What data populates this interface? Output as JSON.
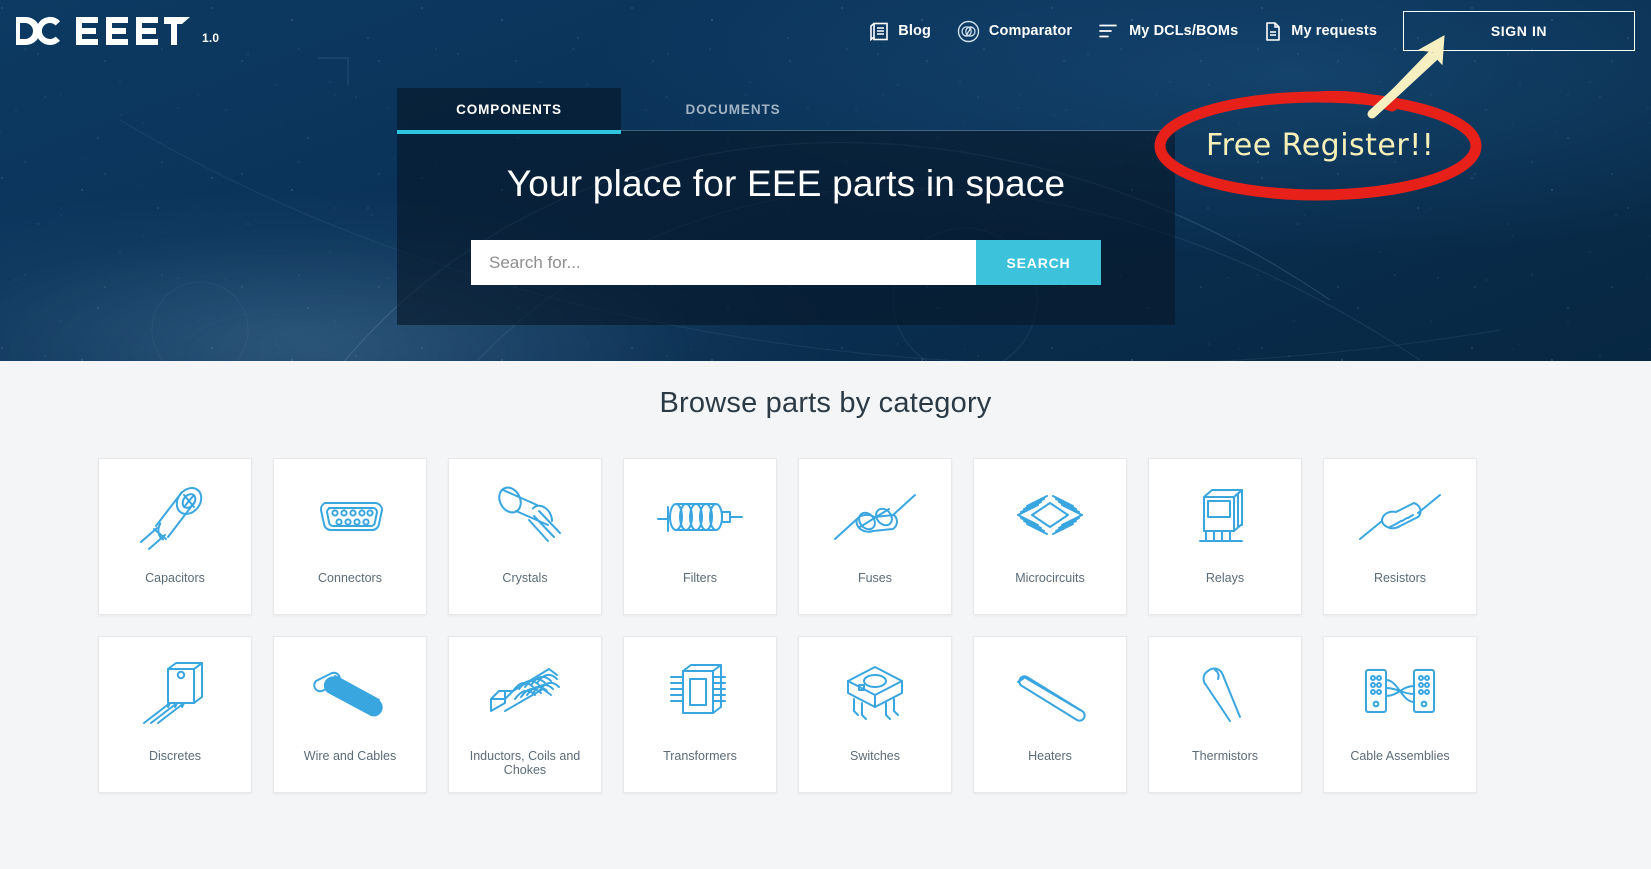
{
  "brand": {
    "logo_text": "DOEEET",
    "version": "1.0",
    "accent_cyan": "#3cc2da",
    "icon_blue": "#3aa6e0",
    "hero_bg": "#0b3258"
  },
  "nav": {
    "items": [
      {
        "label": "Blog",
        "icon": "book-icon"
      },
      {
        "label": "Comparator",
        "icon": "comparator-icon"
      },
      {
        "label": "My DCLs/BOMs",
        "icon": "list-icon"
      },
      {
        "label": "My requests",
        "icon": "document-icon"
      }
    ],
    "signin_label": "SIGN IN"
  },
  "hero": {
    "tabs": [
      {
        "label": "COMPONENTS",
        "active": true
      },
      {
        "label": "DOCUMENTS",
        "active": false
      }
    ],
    "title": "Your place for EEE parts in space",
    "search_placeholder": "Search for...",
    "search_value": "",
    "search_button": "SEARCH"
  },
  "annotation": {
    "text": "Free Register!!",
    "ellipse_color": "#e8201a",
    "text_color": "#f7f0b8",
    "arrow_color": "#f6efc2"
  },
  "browse": {
    "title": "Browse parts by category",
    "categories": [
      {
        "label": "Capacitors",
        "icon": "capacitor-icon"
      },
      {
        "label": "Connectors",
        "icon": "connector-icon"
      },
      {
        "label": "Crystals",
        "icon": "crystal-icon"
      },
      {
        "label": "Filters",
        "icon": "filter-icon"
      },
      {
        "label": "Fuses",
        "icon": "fuse-icon"
      },
      {
        "label": "Microcircuits",
        "icon": "microcircuit-icon"
      },
      {
        "label": "Relays",
        "icon": "relay-icon"
      },
      {
        "label": "Resistors",
        "icon": "resistor-icon"
      },
      {
        "label": "Discretes",
        "icon": "discrete-icon"
      },
      {
        "label": "Wire and Cables",
        "icon": "wire-icon"
      },
      {
        "label": "Inductors, Coils and Chokes",
        "icon": "inductor-icon"
      },
      {
        "label": "Transformers",
        "icon": "transformer-icon"
      },
      {
        "label": "Switches",
        "icon": "switch-icon"
      },
      {
        "label": "Heaters",
        "icon": "heater-icon"
      },
      {
        "label": "Thermistors",
        "icon": "thermistor-icon"
      },
      {
        "label": "Cable Assemblies",
        "icon": "cable-assembly-icon"
      }
    ]
  }
}
